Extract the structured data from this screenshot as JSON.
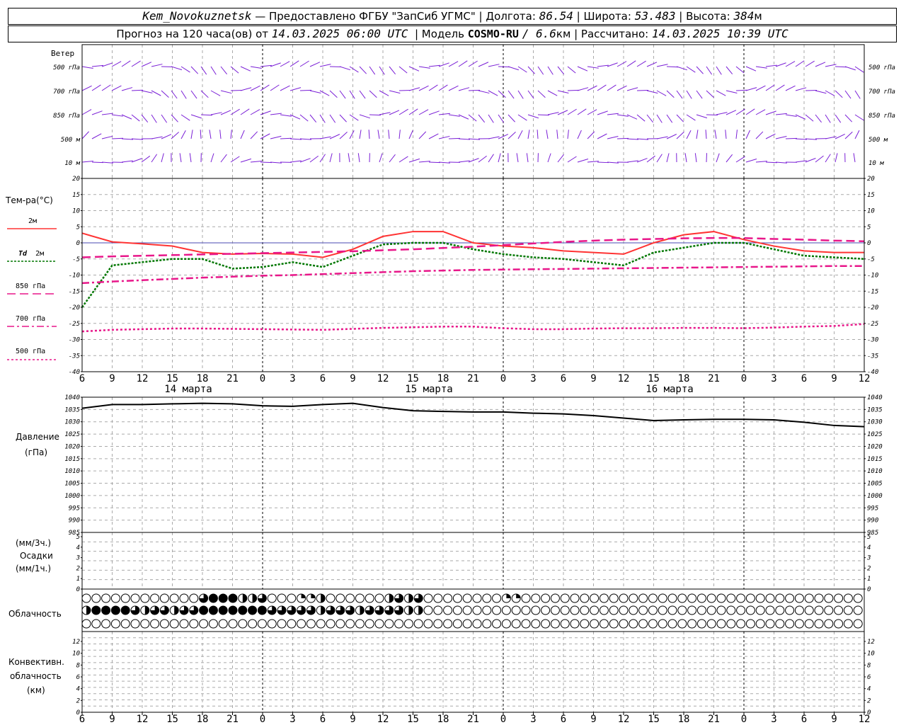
{
  "header": {
    "station": "Kem_Novokuznetsk",
    "provider": "— Предоставлено ФГБУ \"ЗапСиб УГМС\"",
    "lon_label": "Долгота:",
    "lon": "86.54",
    "lat_label": "Широта:",
    "lat": "53.483",
    "alt_label": "Высота:",
    "alt": "384",
    "alt_unit": "м",
    "forecast_text": "Прогноз на 120 часа(ов) от",
    "forecast_time": "14.03.2025 06:00 UTC",
    "model_label": "Модель",
    "model_name": "COSMO-RU",
    "model_res": "/ 6.6",
    "model_res_unit": "км",
    "calc_label": "Рассчитано:",
    "calc_time": "14.03.2025 10:39 UTC"
  },
  "labels": {
    "wind": "Ветер",
    "wind_levels": [
      "500 гПа",
      "700 гПа",
      "850 гПа",
      "500 м",
      "10 м"
    ],
    "temp": "Тем-ра(°C)",
    "t2m": "2м",
    "td": "Td",
    "td2m": "2м",
    "t850": "850 гПа",
    "t700": "700 гПа",
    "t500": "500 гПа",
    "pressure": "Давление",
    "pressure_unit": "(гПа)",
    "precip_unit3": "(мм/3ч.)",
    "precip": "Осадки",
    "precip_unit1": "(мм/1ч.)",
    "cloud": "Облачность",
    "conv1": "Конвективн.",
    "conv2": "облачность",
    "conv3": "(км)"
  },
  "colors": {
    "t2m": "#ff3333",
    "td": "#007700",
    "t850": "#e8178a",
    "t700": "#e8178a",
    "t500": "#e8178a",
    "wind": "#7a1fd6",
    "grid": "#aaaaaa",
    "pressure": "#000000"
  },
  "chart_data": [
    {
      "type": "line",
      "name": "temperature",
      "x_ticks": [
        "6",
        "9",
        "12",
        "15",
        "18",
        "21",
        "0",
        "3",
        "6",
        "9",
        "12",
        "15",
        "18",
        "21",
        "0",
        "3",
        "6",
        "9",
        "12",
        "15",
        "18",
        "21",
        "0",
        "3",
        "6",
        "9",
        "12"
      ],
      "day_labels": [
        "14 марта",
        "15 марта",
        "16 марта"
      ],
      "y_ticks": [
        "20",
        "15",
        "10",
        "5",
        "0",
        "-5",
        "-10",
        "-15",
        "-20",
        "-25",
        "-30",
        "-35",
        "-40"
      ],
      "ylim": [
        -40,
        20
      ],
      "x": [
        0,
        3,
        6,
        9,
        12,
        15,
        18,
        21,
        24,
        27,
        30,
        33,
        36,
        39,
        42,
        45,
        48,
        51,
        54,
        57,
        60,
        63,
        66,
        69,
        72,
        75,
        78
      ],
      "series": [
        {
          "name": "2м",
          "values": [
            3,
            0.3,
            -0.3,
            -1,
            -3,
            -3.5,
            -3.3,
            -3.5,
            -4.5,
            -2,
            2,
            3.5,
            3.5,
            0,
            -1,
            -1.5,
            -2.5,
            -3,
            -3.5,
            0,
            2.5,
            3.5,
            1,
            -1,
            -2.5,
            -3,
            -3
          ]
        },
        {
          "name": "Td 2м",
          "values": [
            -20,
            -7,
            -6,
            -5,
            -5,
            -8,
            -7.5,
            -6,
            -7.5,
            -4,
            -0.5,
            0,
            0,
            -2,
            -3.5,
            -4.5,
            -5,
            -6,
            -7,
            -3,
            -1.5,
            0,
            0,
            -2,
            -4,
            -4.5,
            -5
          ]
        },
        {
          "name": "850 гПа",
          "values": [
            -4.5,
            -4.2,
            -4,
            -3.8,
            -3.6,
            -3.4,
            -3.2,
            -3,
            -2.8,
            -2.6,
            -2.3,
            -2,
            -1.6,
            -1.2,
            -0.7,
            -0.2,
            0.3,
            0.7,
            1,
            1.2,
            1.4,
            1.5,
            1.5,
            1.2,
            1,
            0.7,
            0.5
          ]
        },
        {
          "name": "700 гПа",
          "values": [
            -12.5,
            -12,
            -11.6,
            -11.2,
            -10.8,
            -10.5,
            -10.2,
            -10,
            -9.7,
            -9.4,
            -9.1,
            -8.8,
            -8.6,
            -8.4,
            -8.3,
            -8.2,
            -8.1,
            -8,
            -7.9,
            -7.8,
            -7.7,
            -7.6,
            -7.5,
            -7.4,
            -7.3,
            -7.2,
            -7.2
          ]
        },
        {
          "name": "500 гПа",
          "values": [
            -27.5,
            -27,
            -26.8,
            -26.6,
            -26.6,
            -26.7,
            -26.8,
            -26.9,
            -27,
            -26.7,
            -26.4,
            -26.2,
            -26,
            -26,
            -26.5,
            -26.8,
            -26.8,
            -26.6,
            -26.5,
            -26.5,
            -26.4,
            -26.4,
            -26.5,
            -26.3,
            -26,
            -25.8,
            -25.2
          ]
        }
      ]
    },
    {
      "type": "line",
      "name": "pressure",
      "y_ticks": [
        "1040",
        "1035",
        "1030",
        "1025",
        "1020",
        "1015",
        "1010",
        "1005",
        "1000",
        "995",
        "990",
        "985"
      ],
      "ylim": [
        985,
        1040
      ],
      "x": [
        0,
        3,
        6,
        9,
        12,
        15,
        18,
        21,
        24,
        27,
        30,
        33,
        36,
        39,
        42,
        45,
        48,
        51,
        54,
        57,
        60,
        63,
        66,
        69,
        72,
        75,
        78
      ],
      "values": [
        1035.5,
        1037,
        1037,
        1037.3,
        1037.5,
        1037.3,
        1036.5,
        1036.3,
        1037,
        1037.5,
        1035.8,
        1034.5,
        1034.2,
        1034,
        1034,
        1033.5,
        1033.2,
        1032.5,
        1031.5,
        1030.5,
        1030.8,
        1031,
        1031,
        1030.8,
        1029.8,
        1028.5,
        1028
      ]
    },
    {
      "type": "bar",
      "name": "precipitation",
      "y_ticks": [
        "5",
        "4",
        "3",
        "2",
        "1",
        "0"
      ],
      "ylim": [
        0,
        5
      ],
      "values": []
    },
    {
      "type": "line",
      "name": "convective_cloud",
      "y_ticks": [
        "12",
        "10",
        "8",
        "6",
        "4",
        "2",
        "0"
      ],
      "ylim": [
        0,
        13
      ],
      "values": []
    }
  ],
  "cloud_rows": [
    [
      0,
      0,
      0,
      0,
      0,
      0,
      0,
      0,
      0,
      0,
      0,
      0,
      3,
      4,
      4,
      4,
      2,
      2,
      3,
      0,
      0,
      0,
      1,
      1,
      2,
      0,
      0,
      0,
      0,
      0,
      0,
      2,
      3,
      2,
      3,
      0,
      0,
      0,
      0,
      0,
      0,
      0,
      0,
      1,
      1,
      0,
      0,
      0,
      0,
      0,
      0,
      0,
      0,
      0,
      0,
      0,
      0,
      0,
      0,
      0,
      0,
      0,
      0,
      0,
      0,
      0,
      0,
      0,
      0,
      0,
      0,
      0,
      0,
      0,
      0,
      0,
      0,
      0,
      0,
      0,
      0
    ],
    [
      2,
      4,
      4,
      4,
      4,
      3,
      2,
      3,
      3,
      2,
      3,
      3,
      4,
      4,
      4,
      4,
      4,
      4,
      4,
      3,
      3,
      3,
      3,
      3,
      2,
      3,
      3,
      3,
      2,
      3,
      3,
      3,
      3,
      2,
      2,
      0,
      0,
      0,
      0,
      0,
      0,
      0,
      0,
      0,
      0,
      0,
      0,
      0,
      0,
      0,
      0,
      0,
      0,
      0,
      0,
      0,
      0,
      0,
      0,
      0,
      0,
      0,
      0,
      0,
      0,
      0,
      0,
      0,
      0,
      0,
      0,
      0,
      0,
      0,
      0,
      0,
      0,
      0,
      0,
      0,
      0
    ],
    [
      0,
      0,
      0,
      0,
      0,
      0,
      0,
      0,
      0,
      0,
      0,
      0,
      0,
      0,
      0,
      0,
      0,
      0,
      0,
      0,
      0,
      0,
      0,
      0,
      0,
      0,
      0,
      0,
      0,
      0,
      0,
      0,
      0,
      0,
      0,
      0,
      0,
      0,
      0,
      0,
      0,
      0,
      0,
      0,
      0,
      0,
      0,
      0,
      0,
      0,
      0,
      0,
      0,
      0,
      0,
      0,
      0,
      0,
      0,
      0,
      0,
      0,
      0,
      0,
      0,
      0,
      0,
      0,
      0,
      0,
      0,
      0,
      0,
      0,
      0,
      0,
      0,
      0,
      0,
      0,
      0
    ]
  ]
}
